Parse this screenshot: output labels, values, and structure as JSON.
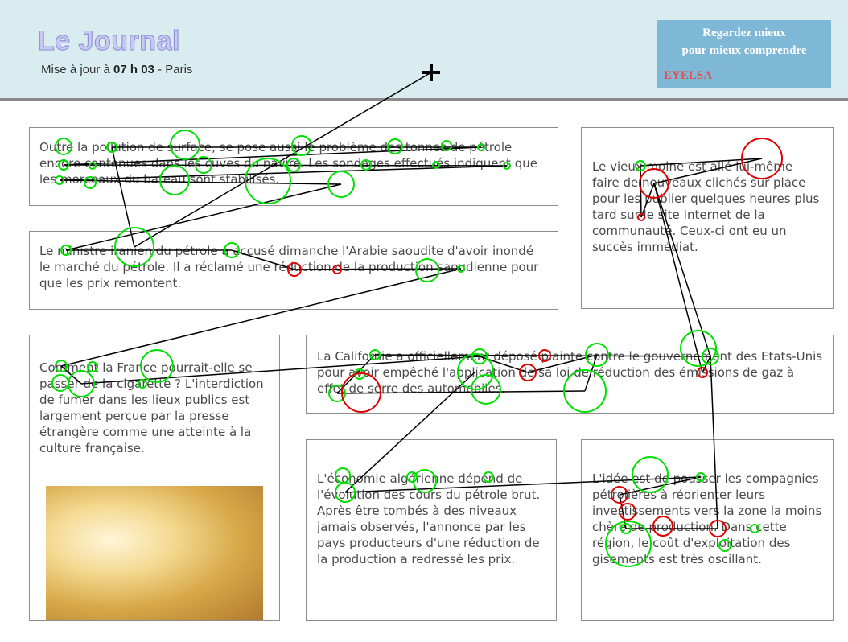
{
  "header": {
    "logo": "Le Journal",
    "update_prefix": "Mise à jour à ",
    "update_time": "07 h 03",
    "update_suffix": " - Paris"
  },
  "ad": {
    "line1": "Regardez mieux",
    "line2": "pour mieux comprendre",
    "brand": "EYELSA"
  },
  "articles": {
    "pollution": "Outre la pollution de surface, se pose aussi le problème des tonnes de pétrole encore contenues dans les cuves du navire. Les sondages effectués indiquent que les morceaux du bateau sont stabilisés.",
    "opep": "Le ministre iranien du pétrole a accusé dimanche l'Arabie saoudite d'avoir inondé le marché du pétrole. Il a réclamé une réduction de la production saoudienne pour que les prix remontent.",
    "moine": "Le vieux moine est allé lui-même faire de nouveaux clichés sur place pour les publier quelques heures plus tard sur le site Internet de la communauté. Ceux-ci ont eu un succès immédiat.",
    "cigarette": "Comment la France pourrait-elle se passer de la cigarette ? L'interdiction de fumer dans les lieux publics est largement perçue par la presse étrangère comme une atteinte à la culture française.",
    "californie": "La Californie a officiellement déposé plainte contre le gouvernement des Etats-Unis pour avoir empêché l'application de sa loi de réduction des émissions de gaz à effet de serre des automobiles.",
    "economie": "L'économie algérienne dépend de l'évolution des cours du pétrole brut. Après être tombés à des niveaux jamais observés, l'annonce par les pays producteurs d'une réduction de la production a redressé les prix.",
    "idee": "L'idée est de pousser les compagnies pétrolières à réorienter leurs investissements vers la zone la moins chère de production. Dans cette région, le coût d'exploitation des gisements est très oscillant."
  },
  "colors": {
    "fixation_normal": "#00e000",
    "fixation_regression": "#e00000",
    "scanpath": "#000000"
  }
}
